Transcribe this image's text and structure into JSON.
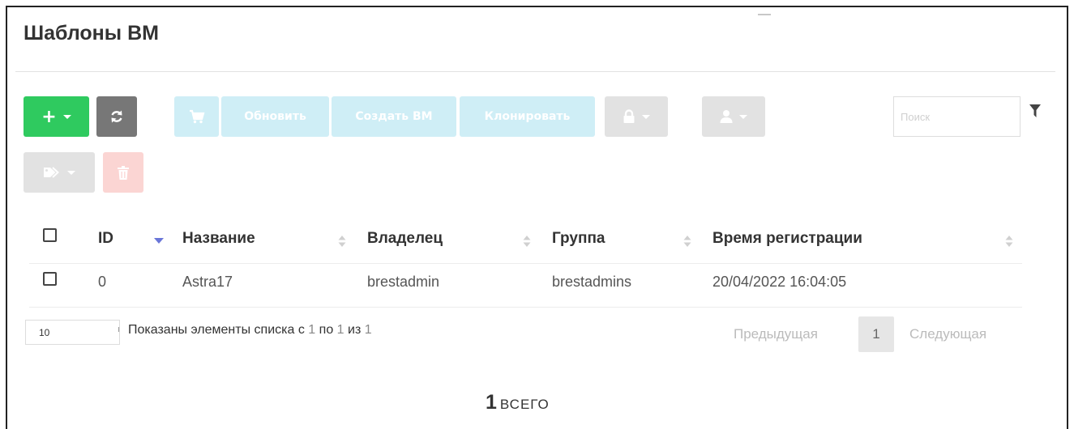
{
  "page": {
    "title": "Шаблоны ВМ"
  },
  "toolbar": {
    "add_label": "+",
    "update_label": "Обновить",
    "create_vm_label": "Создать ВМ",
    "clone_label": "Клонировать"
  },
  "search": {
    "placeholder": "Поиск",
    "value": ""
  },
  "table": {
    "columns": [
      "ID",
      "Название",
      "Владелец",
      "Группа",
      "Время регистрации"
    ],
    "sorted_column": "ID",
    "rows": [
      {
        "id": "0",
        "name": "Astra17",
        "owner": "brestadmin",
        "group": "brestadmins",
        "registered": "20/04/2022 16:04:05"
      }
    ]
  },
  "footer": {
    "page_length": "10",
    "info_prefix": "Показаны элементы списка с",
    "info_from": "1",
    "info_by": "по",
    "info_to": "1",
    "info_of": "из",
    "info_total": "1",
    "prev_label": "Предыдущая",
    "current_page": "1",
    "next_label": "Следующая"
  },
  "summary": {
    "count": "1",
    "word": "ВСЕГО"
  },
  "colors": {
    "accent_green": "#2fca5f",
    "info_light": "#cfeef6",
    "danger_light": "#fbd5d3",
    "sort_active": "#6a76d8"
  },
  "icons": [
    "plus-icon",
    "refresh-icon",
    "cart-icon",
    "lock-icon",
    "user-icon",
    "tag-icon",
    "trash-icon",
    "filter-icon"
  ]
}
